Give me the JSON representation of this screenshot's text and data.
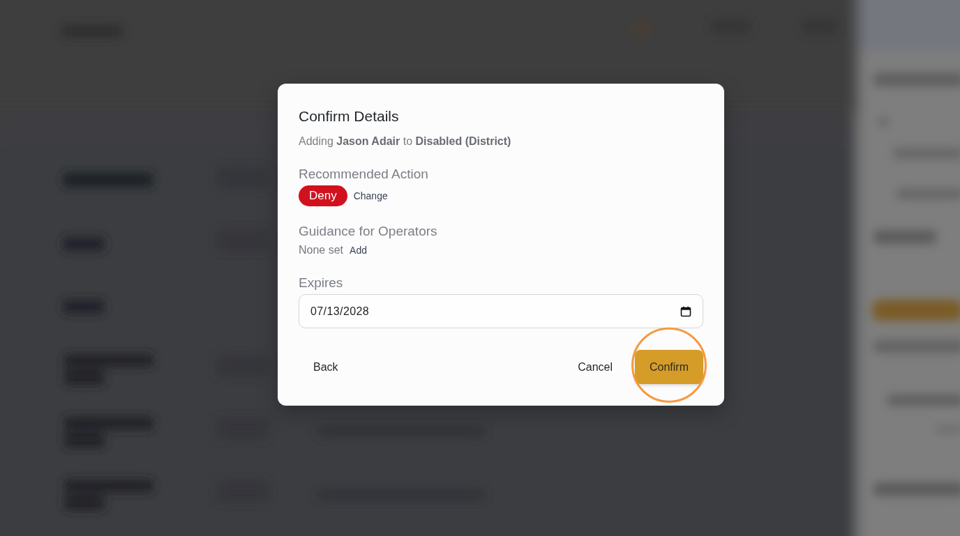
{
  "dialog": {
    "title": "Confirm Details",
    "subtitle": "Adding **Jason Adair** to **Disabled (District)**",
    "sections": [
      {
        "kind": "badge",
        "label": "Recommended Action",
        "value": "Deny",
        "link": "Change"
      },
      {
        "kind": "text",
        "label": "Guidance for Operators",
        "value": "None set",
        "link": "Add"
      },
      {
        "kind": "date",
        "label": "Expires",
        "value": "07/13/2028"
      }
    ],
    "footer": {
      "start": [
        {
          "label": "Back",
          "kind": "plain",
          "highlighted": false
        }
      ],
      "end": [
        {
          "label": "Cancel",
          "kind": "plain",
          "highlighted": false
        },
        {
          "label": "Confirm",
          "kind": "primary",
          "highlighted": true
        }
      ]
    }
  }
}
